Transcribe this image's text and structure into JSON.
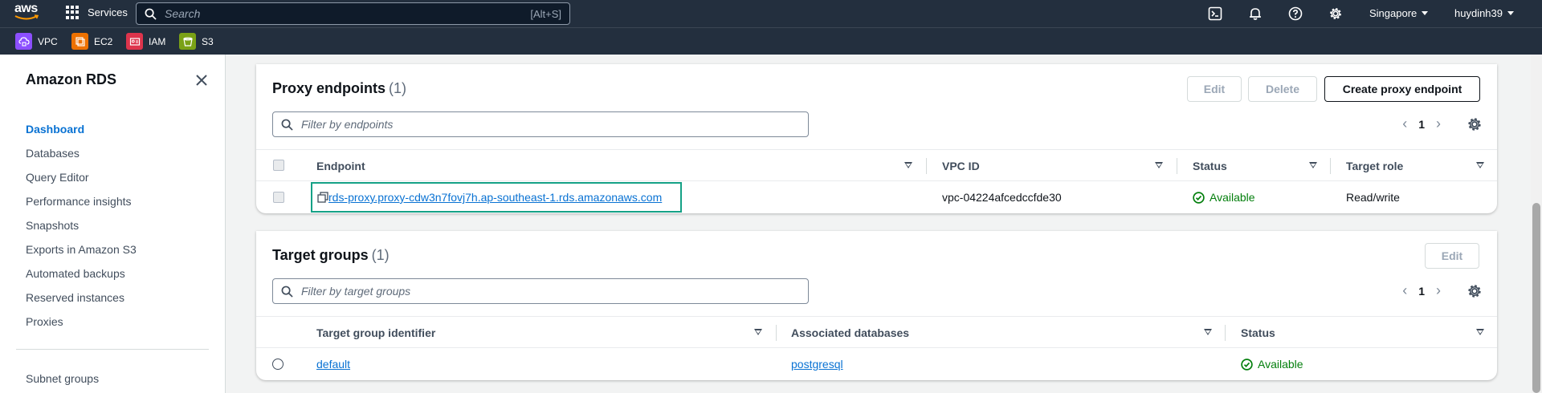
{
  "nav": {
    "logo_text": "aws",
    "services_label": "Services",
    "search_placeholder": "Search",
    "search_shortcut": "[Alt+S]",
    "region": "Singapore",
    "user": "huydinh39"
  },
  "favorites": [
    {
      "label": "VPC",
      "color": "#8c4fff"
    },
    {
      "label": "EC2",
      "color": "#ed7100"
    },
    {
      "label": "IAM",
      "color": "#dd344c"
    },
    {
      "label": "S3",
      "color": "#7aa116"
    }
  ],
  "sidebar": {
    "title": "Amazon RDS",
    "items": [
      {
        "label": "Dashboard",
        "active": true
      },
      {
        "label": "Databases"
      },
      {
        "label": "Query Editor"
      },
      {
        "label": "Performance insights"
      },
      {
        "label": "Snapshots"
      },
      {
        "label": "Exports in Amazon S3"
      },
      {
        "label": "Automated backups"
      },
      {
        "label": "Reserved instances"
      },
      {
        "label": "Proxies"
      },
      {
        "label": "Subnet groups"
      }
    ]
  },
  "proxy_endpoints": {
    "title": "Proxy endpoints",
    "count": "(1)",
    "buttons": {
      "edit": "Edit",
      "delete": "Delete",
      "create": "Create proxy endpoint"
    },
    "filter_placeholder": "Filter by endpoints",
    "page": "1",
    "columns": [
      "Endpoint",
      "VPC ID",
      "Status",
      "Target role"
    ],
    "rows": [
      {
        "endpoint": "rds-proxy.proxy-cdw3n7fovj7h.ap-southeast-1.rds.amazonaws.com",
        "vpc_id": "vpc-04224afcedccfde30",
        "status": "Available",
        "target_role": "Read/write"
      }
    ]
  },
  "target_groups": {
    "title": "Target groups",
    "count": "(1)",
    "buttons": {
      "edit": "Edit"
    },
    "filter_placeholder": "Filter by target groups",
    "page": "1",
    "columns": [
      "Target group identifier",
      "Associated databases",
      "Status"
    ],
    "rows": [
      {
        "identifier": "default",
        "databases": "postgresql",
        "status": "Available"
      }
    ]
  },
  "colors": {
    "nav_bg": "#232f3e",
    "link": "#0972d3",
    "success": "#037f0c",
    "highlight": "#15a186"
  }
}
